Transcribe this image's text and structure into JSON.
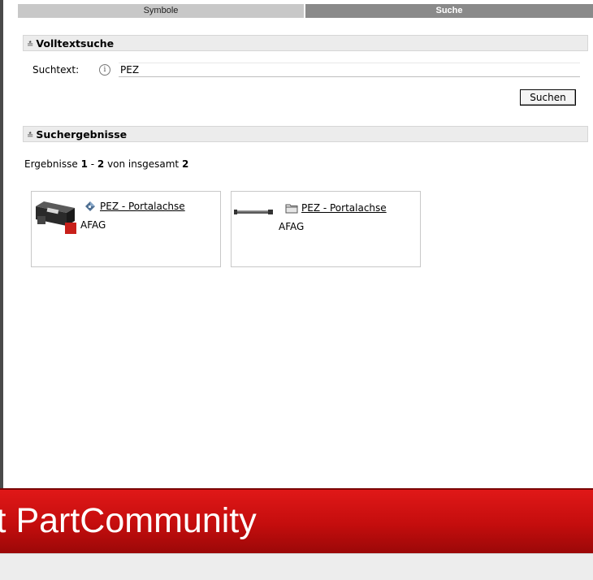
{
  "tabs": [
    {
      "label": "Symbole",
      "active": false
    },
    {
      "label": "Suche",
      "active": true
    }
  ],
  "fulltext_section": {
    "title": "Volltextsuche",
    "search_label": "Suchtext:",
    "search_value": "PEZ",
    "info_icon": "info-icon",
    "search_button": "Suchen"
  },
  "results_section": {
    "title": "Suchergebnisse",
    "summary": {
      "prefix": "Ergebnisse ",
      "from": "1",
      "dash": " - ",
      "to": "2",
      "middle": " von insgesamt ",
      "total": "2"
    },
    "items": [
      {
        "name": "PEZ - Portalachse",
        "manufacturer": "AFAG",
        "type_icon": "part-icon"
      },
      {
        "name": "PEZ - Portalachse",
        "manufacturer": "AFAG",
        "type_icon": "folder-icon"
      }
    ]
  },
  "banner": {
    "text": "it PartCommunity"
  },
  "colors": {
    "banner_red": "#c40d0d",
    "tab_active": "#8a8a8a",
    "tab_inactive": "#c8c8c8"
  }
}
